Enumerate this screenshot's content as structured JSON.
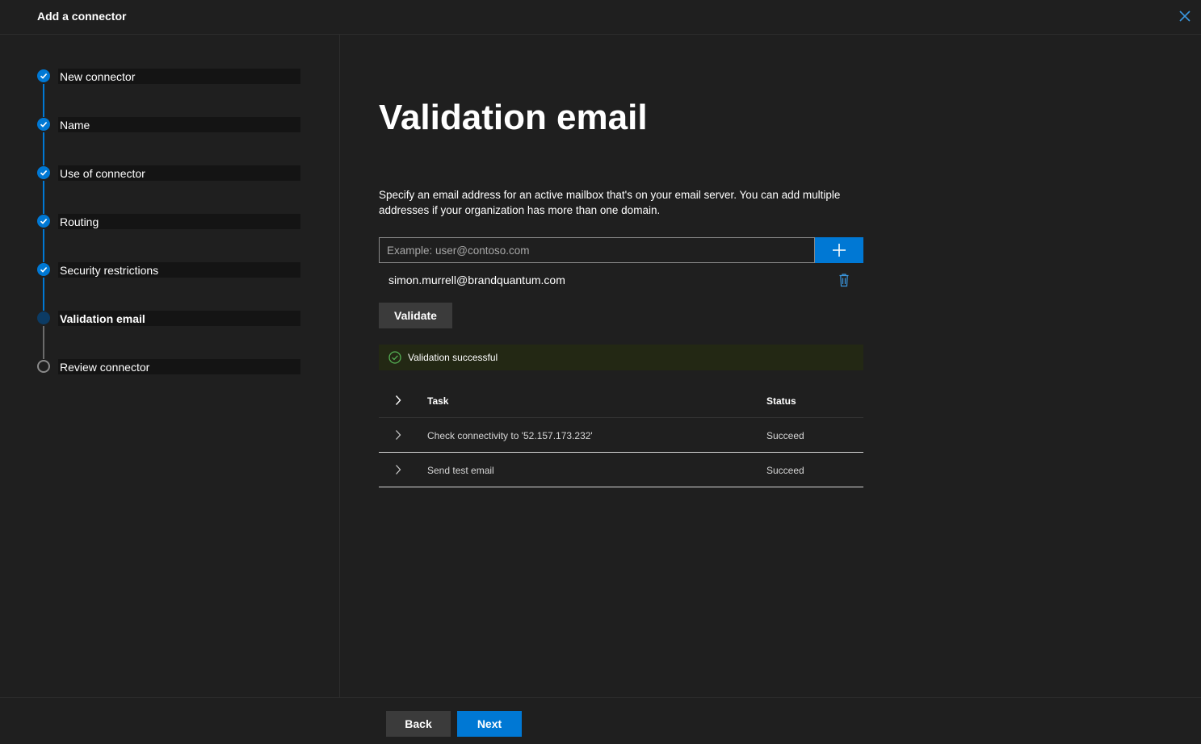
{
  "window": {
    "title": "Add a connector",
    "close_icon": "close-icon"
  },
  "steps": [
    {
      "label": "New connector",
      "state": "done"
    },
    {
      "label": "Name",
      "state": "done"
    },
    {
      "label": "Use of connector",
      "state": "done"
    },
    {
      "label": "Routing",
      "state": "done"
    },
    {
      "label": "Security restrictions",
      "state": "done"
    },
    {
      "label": "Validation email",
      "state": "current"
    },
    {
      "label": "Review connector",
      "state": "todo"
    }
  ],
  "main": {
    "title": "Validation email",
    "description": "Specify an email address for an active mailbox that's on your email server. You can add multiple addresses if your organization has more than one domain.",
    "email_input": {
      "placeholder": "Example: user@contoso.com",
      "value": ""
    },
    "add_icon": "plus-icon",
    "emails": [
      "simon.murrell@brandquantum.com"
    ],
    "validate_label": "Validate",
    "validation_message": "Validation successful",
    "table": {
      "headers": {
        "task": "Task",
        "status": "Status"
      },
      "rows": [
        {
          "task": "Check connectivity to '52.157.173.232'",
          "status": "Succeed"
        },
        {
          "task": "Send test email",
          "status": "Succeed"
        }
      ]
    }
  },
  "footer": {
    "back_label": "Back",
    "next_label": "Next"
  },
  "colors": {
    "background": "#1f1f1f",
    "accent": "#0078d4",
    "success_bg": "#232814",
    "success_icon": "#54b054"
  }
}
